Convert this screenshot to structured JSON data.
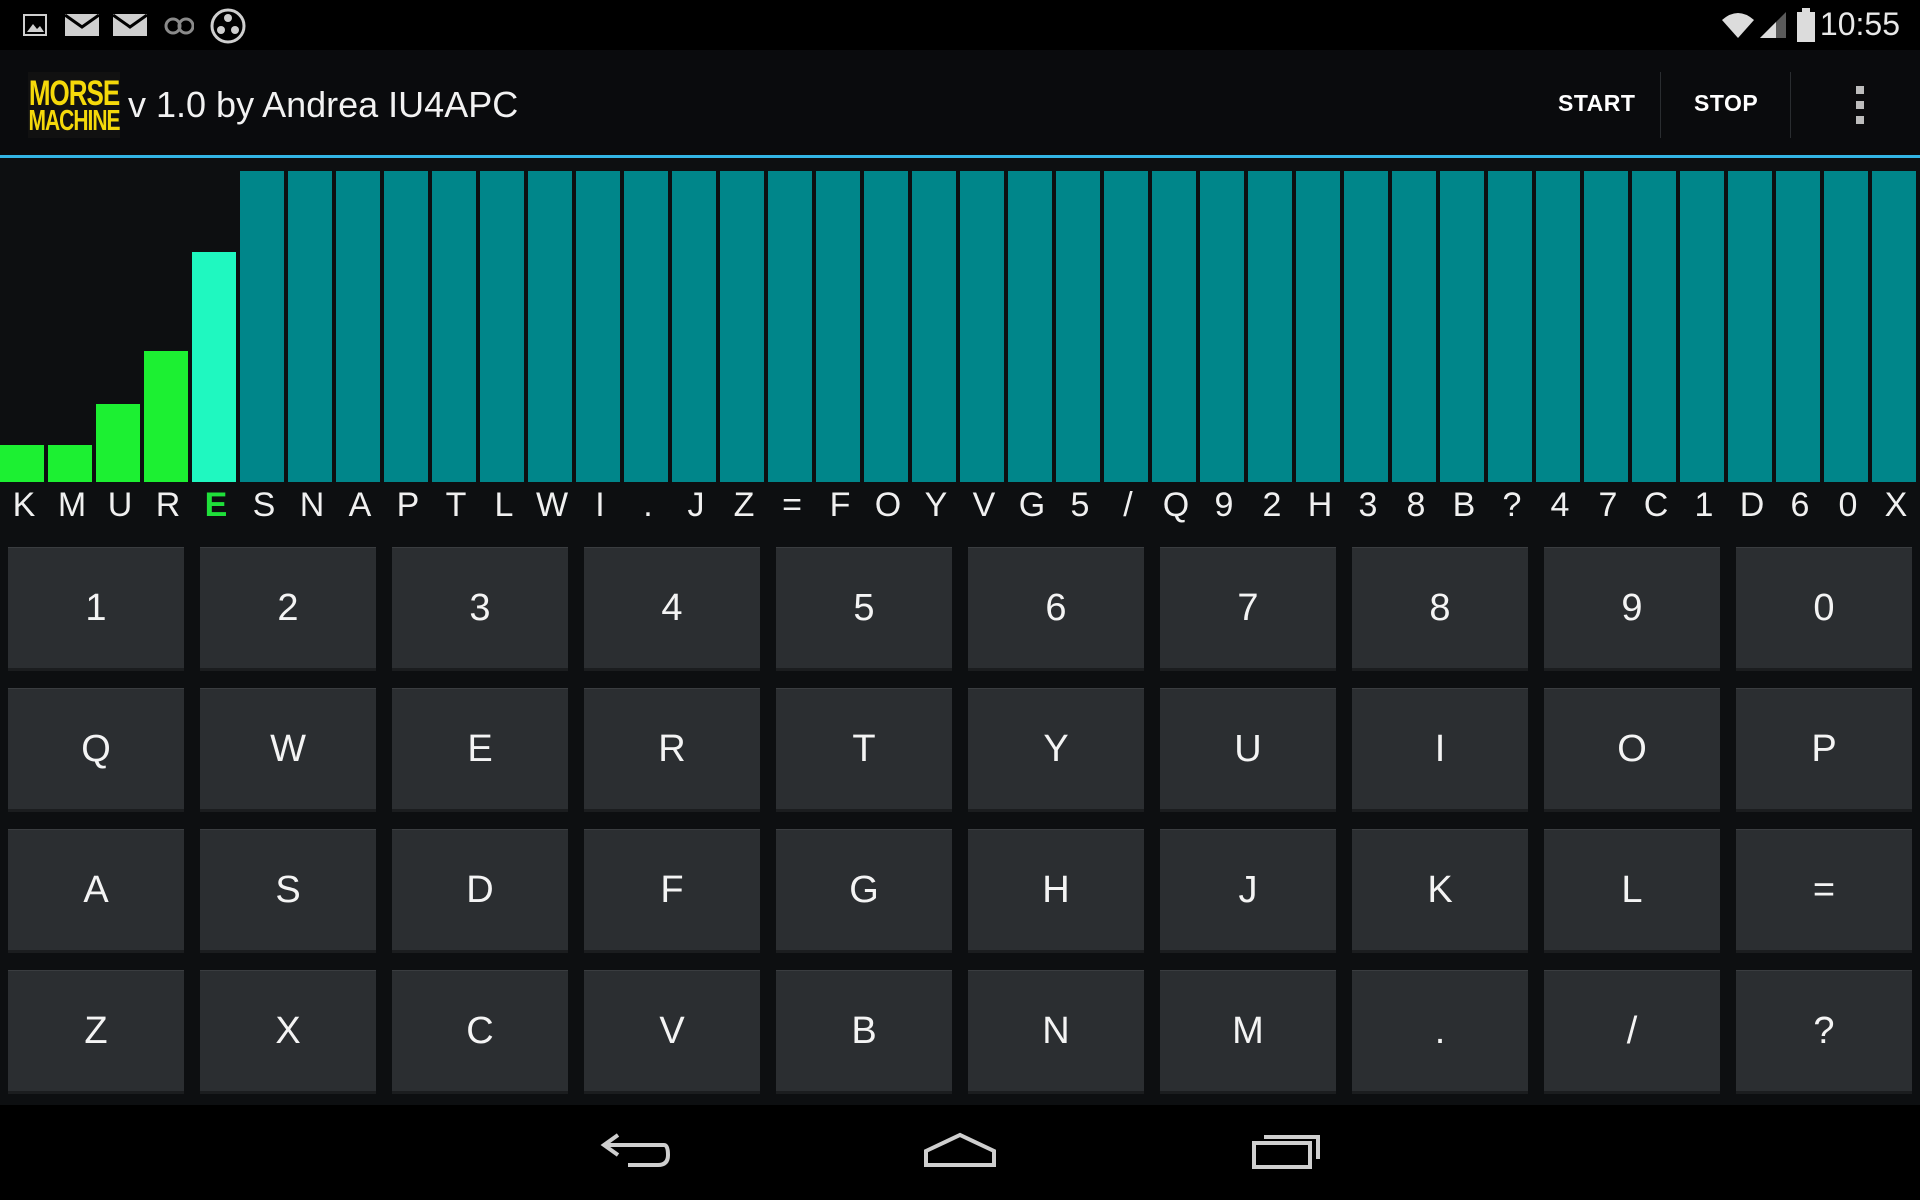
{
  "status_bar": {
    "time": "10:55",
    "left_icons": [
      "gallery-icon",
      "gmail-icon",
      "email-icon",
      "voicemail-icon",
      "app-icon"
    ],
    "right_icons": [
      "wifi-icon",
      "signal-icon",
      "battery-icon"
    ]
  },
  "action_bar": {
    "logo_line1": "MORSE",
    "logo_line2": "MACHINE",
    "title": "v 1.0 by Andrea IU4APC",
    "start_label": "START",
    "stop_label": "STOP",
    "overflow_icon": "overflow-menu-icon"
  },
  "colors": {
    "accent_line": "#33b5e5",
    "bar_full": "#00868a",
    "bar_learned": "#1cf032",
    "bar_current": "#1ff8c0",
    "current_letter": "#1fe03a"
  },
  "chart_data": {
    "type": "bar",
    "categories": [
      "K",
      "M",
      "U",
      "R",
      "E",
      "S",
      "N",
      "A",
      "P",
      "T",
      "L",
      "W",
      "I",
      ".",
      "J",
      "Z",
      "=",
      "F",
      "O",
      "Y",
      "V",
      "G",
      "5",
      "/",
      "Q",
      "9",
      "2",
      "H",
      "3",
      "8",
      "B",
      "?",
      "4",
      "7",
      "C",
      "1",
      "D",
      "6",
      "0",
      "X"
    ],
    "values": [
      0.12,
      0.12,
      0.25,
      0.42,
      0.74,
      1,
      1,
      1,
      1,
      1,
      1,
      1,
      1,
      1,
      1,
      1,
      1,
      1,
      1,
      1,
      1,
      1,
      1,
      1,
      1,
      1,
      1,
      1,
      1,
      1,
      1,
      1,
      1,
      1,
      1,
      1,
      1,
      1,
      1,
      1
    ],
    "current_index": 4,
    "ylim": [
      0,
      1
    ]
  },
  "keypad": {
    "rows": [
      [
        "1",
        "2",
        "3",
        "4",
        "5",
        "6",
        "7",
        "8",
        "9",
        "0"
      ],
      [
        "Q",
        "W",
        "E",
        "R",
        "T",
        "Y",
        "U",
        "I",
        "O",
        "P"
      ],
      [
        "A",
        "S",
        "D",
        "F",
        "G",
        "H",
        "J",
        "K",
        "L",
        "="
      ],
      [
        "Z",
        "X",
        "C",
        "V",
        "B",
        "N",
        "M",
        ".",
        "/",
        "?"
      ]
    ]
  },
  "nav_bar": {
    "icons": [
      "back-icon",
      "home-icon",
      "recents-icon"
    ]
  }
}
